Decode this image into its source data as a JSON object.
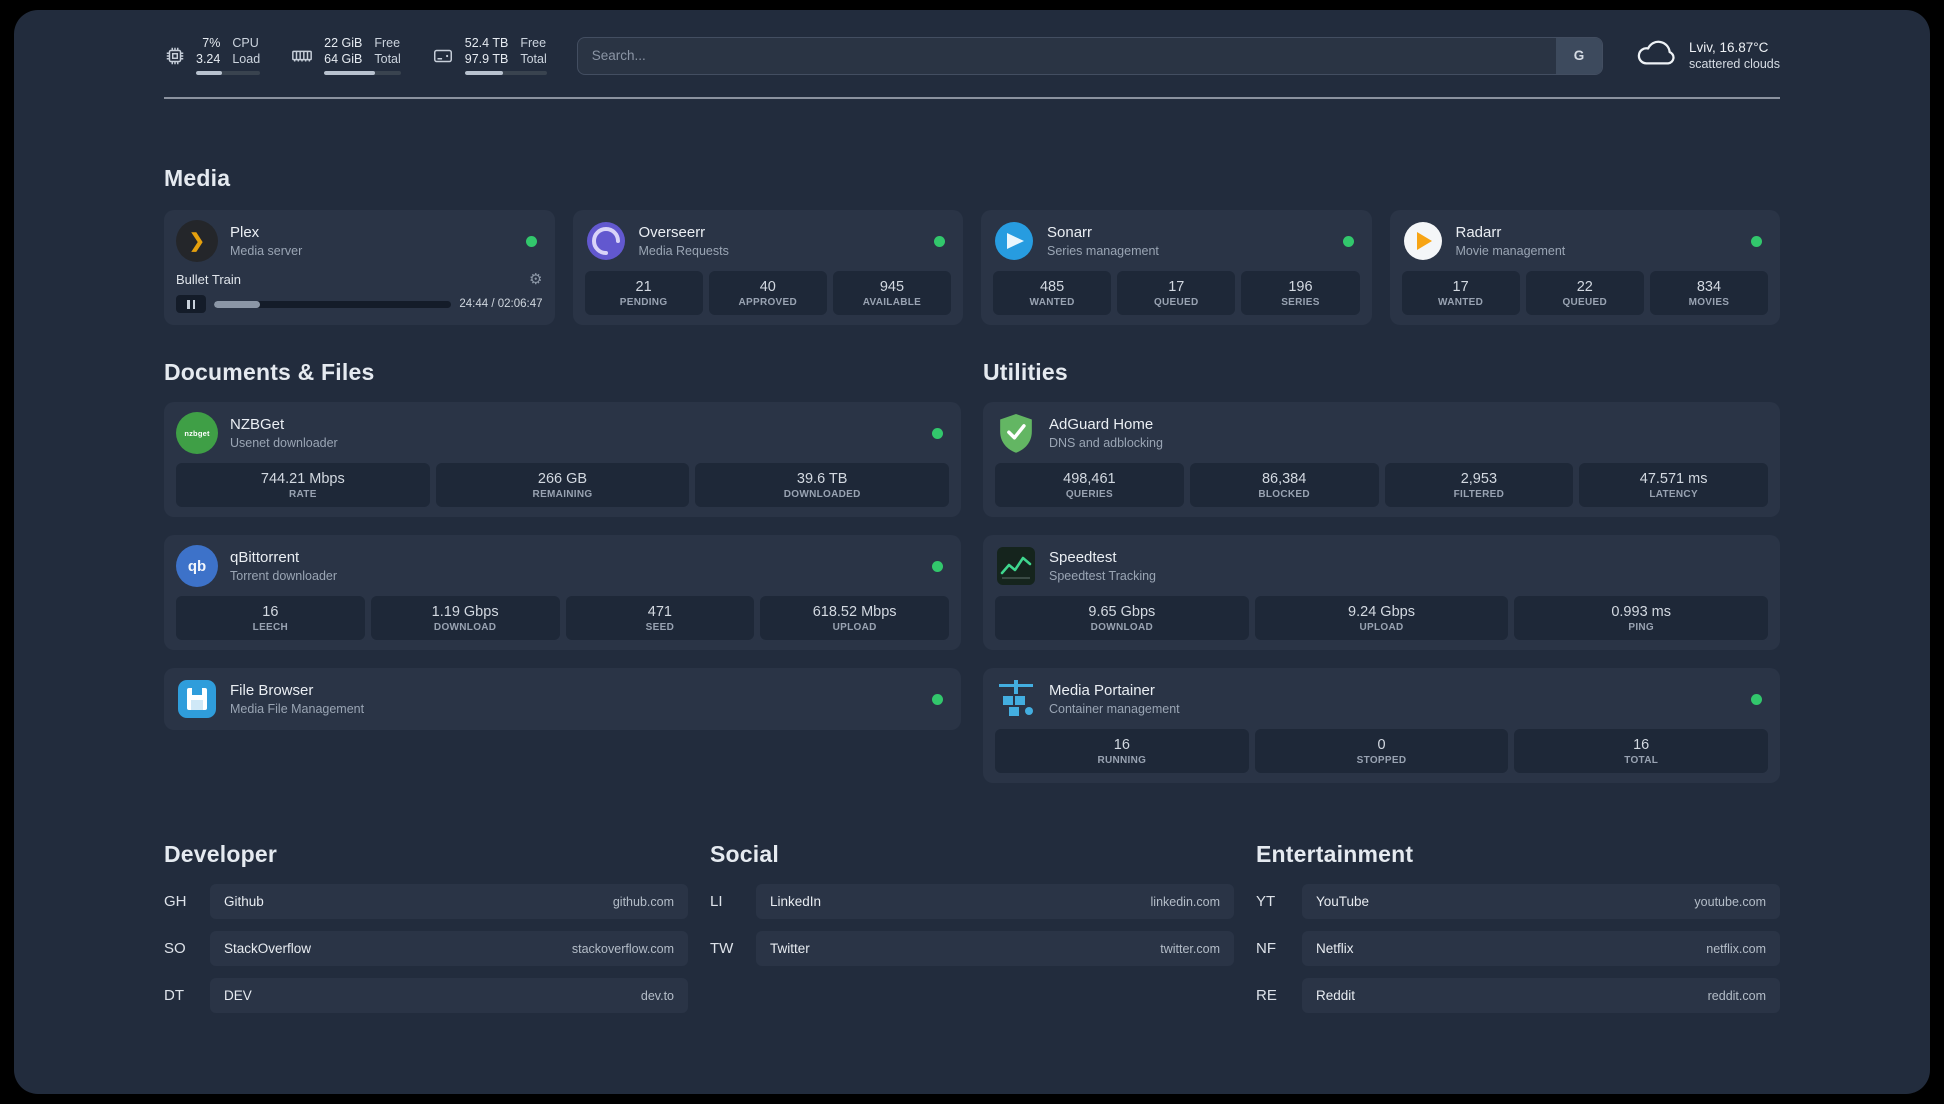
{
  "topbar": {
    "resources": [
      {
        "icon": "cpu-icon",
        "value_top": "7%",
        "value_bottom": "3.24",
        "label_top": "CPU",
        "label_bottom": "Load",
        "bar_percent": 41
      },
      {
        "icon": "memory-icon",
        "value_top": "22 GiB",
        "value_bottom": "64 GiB",
        "label_top": "Free",
        "label_bottom": "Total",
        "bar_percent": 66
      },
      {
        "icon": "disk-icon",
        "value_top": "52.4 TB",
        "value_bottom": "97.9 TB",
        "label_top": "Free",
        "label_bottom": "Total",
        "bar_percent": 47
      }
    ],
    "search": {
      "placeholder": "Search...",
      "provider_label": "G"
    },
    "weather": {
      "location_temp": "Lviv, 16.87°C",
      "condition": "scattered clouds"
    }
  },
  "sections": {
    "media": {
      "title": "Media",
      "services": [
        {
          "name": "Plex",
          "subtitle": "Media server",
          "icon": "plex-icon",
          "online": true,
          "player": {
            "track": "Bullet Train",
            "time": "24:44 / 02:06:47",
            "progress_percent": 19.5
          }
        },
        {
          "name": "Overseerr",
          "subtitle": "Media Requests",
          "icon": "overseerr-icon",
          "online": true,
          "stats": [
            {
              "value": "21",
              "label": "PENDING"
            },
            {
              "value": "40",
              "label": "APPROVED"
            },
            {
              "value": "945",
              "label": "AVAILABLE"
            }
          ]
        },
        {
          "name": "Sonarr",
          "subtitle": "Series management",
          "icon": "sonarr-icon",
          "online": true,
          "stats": [
            {
              "value": "485",
              "label": "WANTED"
            },
            {
              "value": "17",
              "label": "QUEUED"
            },
            {
              "value": "196",
              "label": "SERIES"
            }
          ]
        },
        {
          "name": "Radarr",
          "subtitle": "Movie management",
          "icon": "radarr-icon",
          "online": true,
          "stats": [
            {
              "value": "17",
              "label": "WANTED"
            },
            {
              "value": "22",
              "label": "QUEUED"
            },
            {
              "value": "834",
              "label": "MOVIES"
            }
          ]
        }
      ]
    },
    "documents": {
      "title": "Documents & Files",
      "services": [
        {
          "name": "NZBGet",
          "subtitle": "Usenet downloader",
          "icon": "nzbget-icon",
          "online": true,
          "stats": [
            {
              "value": "744.21 Mbps",
              "label": "RATE"
            },
            {
              "value": "266 GB",
              "label": "REMAINING"
            },
            {
              "value": "39.6 TB",
              "label": "DOWNLOADED"
            }
          ]
        },
        {
          "name": "qBittorrent",
          "subtitle": "Torrent downloader",
          "icon": "qbittorrent-icon",
          "online": true,
          "stats": [
            {
              "value": "16",
              "label": "LEECH"
            },
            {
              "value": "1.19 Gbps",
              "label": "DOWNLOAD"
            },
            {
              "value": "471",
              "label": "SEED"
            },
            {
              "value": "618.52 Mbps",
              "label": "UPLOAD"
            }
          ]
        },
        {
          "name": "File Browser",
          "subtitle": "Media File Management",
          "icon": "filebrowser-icon",
          "online": true,
          "stats": []
        }
      ]
    },
    "utilities": {
      "title": "Utilities",
      "services": [
        {
          "name": "AdGuard Home",
          "subtitle": "DNS and adblocking",
          "icon": "adguard-icon",
          "online": false,
          "stats": [
            {
              "value": "498,461",
              "label": "QUERIES"
            },
            {
              "value": "86,384",
              "label": "BLOCKED"
            },
            {
              "value": "2,953",
              "label": "FILTERED"
            },
            {
              "value": "47.571 ms",
              "label": "LATENCY"
            }
          ]
        },
        {
          "name": "Speedtest",
          "subtitle": "Speedtest Tracking",
          "icon": "speedtest-icon",
          "online": false,
          "stats": [
            {
              "value": "9.65 Gbps",
              "label": "DOWNLOAD"
            },
            {
              "value": "9.24 Gbps",
              "label": "UPLOAD"
            },
            {
              "value": "0.993 ms",
              "label": "PING"
            }
          ]
        },
        {
          "name": "Media Portainer",
          "subtitle": "Container management",
          "icon": "portainer-icon",
          "online": true,
          "stats": [
            {
              "value": "16",
              "label": "RUNNING"
            },
            {
              "value": "0",
              "label": "STOPPED"
            },
            {
              "value": "16",
              "label": "TOTAL"
            }
          ]
        }
      ]
    }
  },
  "bookmarks": [
    {
      "title": "Developer",
      "items": [
        {
          "abbr": "GH",
          "name": "Github",
          "url": "github.com"
        },
        {
          "abbr": "SO",
          "name": "StackOverflow",
          "url": "stackoverflow.com"
        },
        {
          "abbr": "DT",
          "name": "DEV",
          "url": "dev.to"
        }
      ]
    },
    {
      "title": "Social",
      "items": [
        {
          "abbr": "LI",
          "name": "LinkedIn",
          "url": "linkedin.com"
        },
        {
          "abbr": "TW",
          "name": "Twitter",
          "url": "twitter.com"
        }
      ]
    },
    {
      "title": "Entertainment",
      "items": [
        {
          "abbr": "YT",
          "name": "YouTube",
          "url": "youtube.com"
        },
        {
          "abbr": "NF",
          "name": "Netflix",
          "url": "netflix.com"
        },
        {
          "abbr": "RE",
          "name": "Reddit",
          "url": "reddit.com"
        }
      ]
    }
  ],
  "colors": {
    "background": "#222c3d",
    "card": "#2a3446",
    "stat_tile": "#1e2838",
    "status_online": "#32c76c",
    "plex_amber": "#e5a00d",
    "adguard_green": "#63b663",
    "portainer_blue": "#43aee0"
  }
}
